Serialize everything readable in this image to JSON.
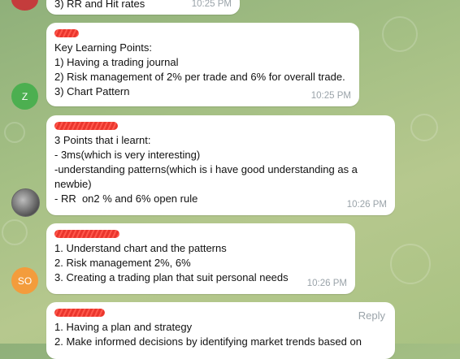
{
  "messages": [
    {
      "lines": [
        "3) RR and Hit rates"
      ],
      "time": "10:25 PM"
    },
    {
      "lines": [
        "Key Learning Points:",
        "1) Having a trading journal",
        "2) Risk management of 2% per trade and 6% for overall trade.",
        "3) Chart Pattern"
      ],
      "time": "10:25 PM",
      "avatar": {
        "initial": "Z",
        "color": "#4caf50"
      }
    },
    {
      "lines": [
        "3 Points that i learnt:",
        "- 3ms(which is very interesting)",
        "-understanding patterns(which is i have good understanding as a",
        "newbie)",
        "- RR  on2 % and 6% open rule"
      ],
      "time": "10:26 PM"
    },
    {
      "lines": [
        "1. Understand chart and the patterns",
        "2. Risk management 2%, 6%",
        "3. Creating a trading plan that suit personal needs"
      ],
      "time": "10:26 PM",
      "avatar": {
        "initial": "SO",
        "color": "#f39c3c"
      }
    },
    {
      "lines": [
        "1. Having a plan and strategy",
        "2. Make informed decisions by identifying market trends based on"
      ],
      "reply_label": "Reply"
    }
  ]
}
